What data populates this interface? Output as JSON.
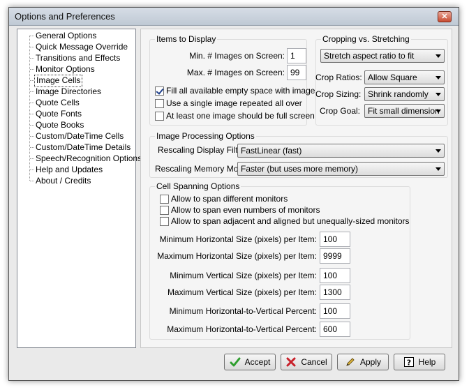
{
  "window": {
    "title": "Options and Preferences"
  },
  "tree": {
    "items": [
      {
        "label": "General Options",
        "selected": false
      },
      {
        "label": "Quick Message Override",
        "selected": false
      },
      {
        "label": "Transitions and Effects",
        "selected": false
      },
      {
        "label": "Monitor Options",
        "selected": false
      },
      {
        "label": "Image Cells",
        "selected": true
      },
      {
        "label": "Image Directories",
        "selected": false
      },
      {
        "label": "Quote Cells",
        "selected": false
      },
      {
        "label": "Quote Fonts",
        "selected": false
      },
      {
        "label": "Quote Books",
        "selected": false
      },
      {
        "label": "Custom/DateTime Cells",
        "selected": false
      },
      {
        "label": "Custom/DateTime Details",
        "selected": false
      },
      {
        "label": "Speech/Recognition Options",
        "selected": false
      },
      {
        "label": "Help and Updates",
        "selected": false
      },
      {
        "label": "About / Credits",
        "selected": false
      }
    ]
  },
  "items_to_display": {
    "title": "Items to Display",
    "min_label": "Min. # Images on Screen:",
    "min_value": "1",
    "max_label": "Max. # Images on Screen:",
    "max_value": "99",
    "checks": [
      {
        "label": "Fill all available empty space with images",
        "checked": true
      },
      {
        "label": "Use a single image repeated all over",
        "checked": false
      },
      {
        "label": "At least one image should be full screen",
        "checked": false
      }
    ]
  },
  "cropping": {
    "title": "Cropping vs. Stretching",
    "mode": "Stretch aspect ratio to fit",
    "ratios_label": "Crop Ratios:",
    "ratios_value": "Allow Square",
    "sizing_label": "Crop Sizing:",
    "sizing_value": "Shrink randomly",
    "goal_label": "Crop Goal:",
    "goal_value": "Fit small dimension"
  },
  "processing": {
    "title": "Image Processing Options",
    "filter_label": "Rescaling Display Filter",
    "filter_value": "FastLinear (fast)",
    "memory_label": "Rescaling Memory Mode",
    "memory_value": "Faster (but uses more memory)"
  },
  "spanning": {
    "title": "Cell Spanning Options",
    "checks": [
      {
        "label": "Allow to span different monitors",
        "checked": false
      },
      {
        "label": "Allow to span even numbers of monitors",
        "checked": false
      },
      {
        "label": "Allow to span adjacent and aligned but unequally-sized monitors",
        "checked": false
      }
    ],
    "fields": [
      {
        "label": "Minimum Horizontal Size (pixels) per Item:",
        "value": "100"
      },
      {
        "label": "Maximum Horizontal Size (pixels) per Item:",
        "value": "9999"
      },
      {
        "label": "Minimum Vertical Size (pixels) per Item:",
        "value": "100"
      },
      {
        "label": "Maximum Vertical Size (pixels) per Item:",
        "value": "1300"
      },
      {
        "label": "Minimum Horizontal-to-Vertical  Percent:",
        "value": "100"
      },
      {
        "label": "Maximum Horizontal-to-Vertical  Percent:",
        "value": "600"
      }
    ]
  },
  "buttons": {
    "accept": "Accept",
    "cancel": "Cancel",
    "apply": "Apply",
    "help": "Help"
  },
  "colors": {
    "accept_green": "#2e9e2e",
    "cancel_red": "#c8202a"
  }
}
